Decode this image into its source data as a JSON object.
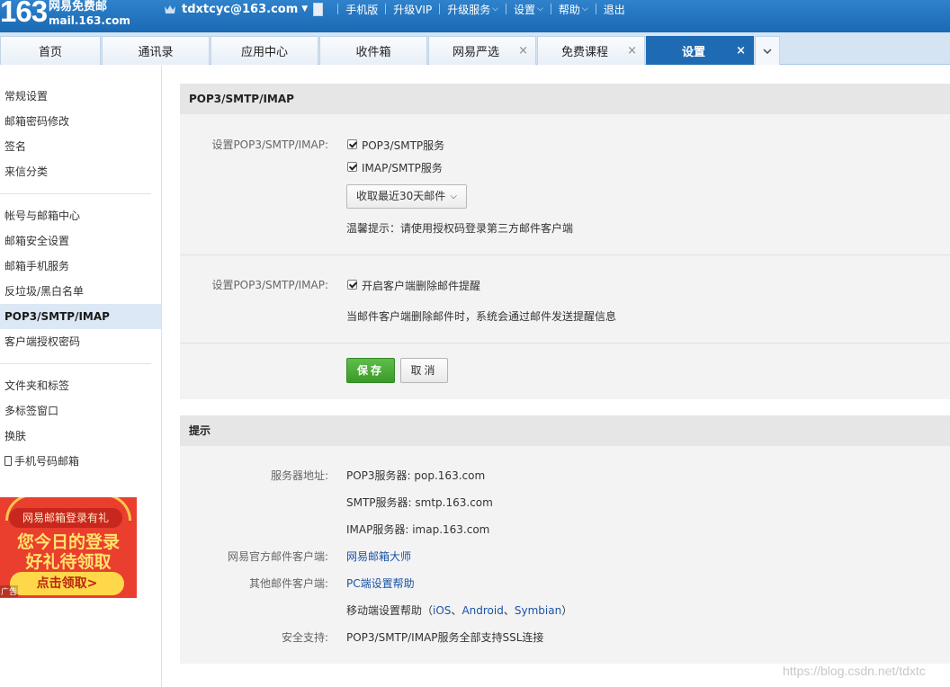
{
  "header": {
    "logo_number": "163",
    "logo_name": "网易免费邮",
    "logo_domain": "mail.163.com",
    "account": "tdxtcyc@163.com",
    "links": [
      "手机版",
      "升级VIP",
      "升级服务",
      "设置",
      "帮助",
      "退出"
    ]
  },
  "tabs": [
    {
      "label": "首页"
    },
    {
      "label": "通讯录"
    },
    {
      "label": "应用中心"
    },
    {
      "label": "收件箱"
    },
    {
      "label": "网易严选",
      "close": "×"
    },
    {
      "label": "免费课程",
      "close": "×"
    },
    {
      "label": "设置",
      "close": "×"
    }
  ],
  "sidebar": {
    "items": [
      "常规设置",
      "邮箱密码修改",
      "签名",
      "来信分类",
      "帐号与邮箱中心",
      "邮箱安全设置",
      "邮箱手机服务",
      "反垃圾/黑白名单",
      "POP3/SMTP/IMAP",
      "客户端授权密码",
      "文件夹和标签",
      "多标签窗口",
      "换肤",
      "手机号码邮箱"
    ]
  },
  "ad": {
    "ribbon": "网易邮箱登录有礼",
    "line1": "您今日的登录",
    "line2": "好礼待领取",
    "button": "点击领取>",
    "tag": "广告"
  },
  "pop3_section": {
    "title": "POP3/SMTP/IMAP",
    "label1": "设置POP3/SMTP/IMAP:",
    "option_pop3": "POP3/SMTP服务",
    "option_imap": "IMAP/SMTP服务",
    "select_value": "收取最近30天邮件",
    "tip": "温馨提示：请使用授权码登录第三方邮件客户端",
    "label2": "设置POP3/SMTP/IMAP:",
    "option_delete_alert": "开启客户端删除邮件提醒",
    "delete_alert_desc": "当邮件客户端删除邮件时，系统会通过邮件发送提醒信息",
    "save": "保存",
    "cancel": "取消"
  },
  "tips_section": {
    "title": "提示",
    "server_label": "服务器地址:",
    "pop3_server": "POP3服务器: pop.163.com",
    "smtp_server": "SMTP服务器: smtp.163.com",
    "imap_server": "IMAP服务器: imap.163.com",
    "official_client_label": "网易官方邮件客户端:",
    "official_client": "网易邮箱大师",
    "other_client_label": "其他邮件客户端:",
    "pc_help": "PC端设置帮助",
    "mobile_help_prefix": "移动端设置帮助（",
    "mobile_ios": "iOS",
    "mobile_sep1": "、",
    "mobile_android": "Android",
    "mobile_sep2": "、",
    "mobile_symbian": "Symbian",
    "mobile_help_suffix": "）",
    "security_label": "安全支持:",
    "security_text": "POP3/SMTP/IMAP服务全部支持SSL连接"
  },
  "watermark": "https://blog.csdn.net/tdxtc"
}
